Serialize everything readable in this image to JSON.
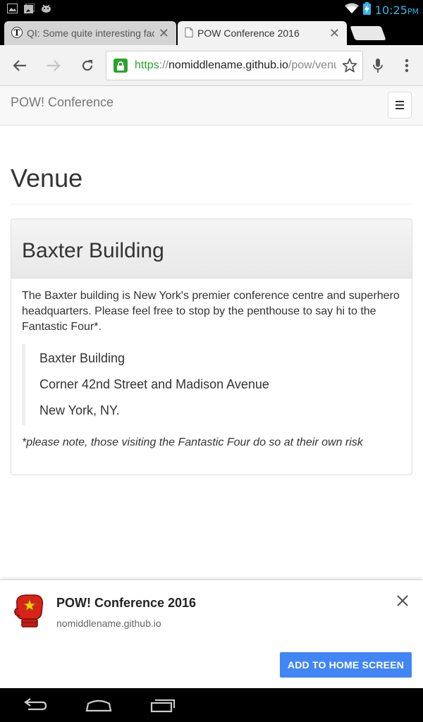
{
  "status_bar": {
    "time": "10:25",
    "ampm": "PM",
    "left_icons": [
      "image-icon",
      "photo-upload-icon",
      "android-icon"
    ],
    "right_icons": [
      "wifi-icon",
      "battery-charging-icon"
    ]
  },
  "tabs": [
    {
      "title": "QI: Some quite interesting facts",
      "favicon": "telegraph-icon",
      "active": false
    },
    {
      "title": "POW Conference 2016",
      "favicon": "page-icon",
      "active": true
    }
  ],
  "toolbar": {
    "url_scheme": "https",
    "url_sep": "://",
    "url_host": "nomiddlename.github.io",
    "url_path": "/pow/venue"
  },
  "page": {
    "brand": "POW! Conference",
    "heading": "Venue",
    "panel_title": "Baxter Building",
    "description": "The Baxter building is New York's premier conference centre and superhero headquarters. Please feel free to stop by the penthouse to say hi to the Fantastic Four*.",
    "address": [
      "Baxter Building",
      "Corner 42nd Street and Madison Avenue",
      "New York, NY."
    ],
    "note": "*please note, those visiting the Fantastic Four do so at their own risk"
  },
  "banner": {
    "title": "POW! Conference 2016",
    "url": "nomiddlename.github.io",
    "button": "ADD TO HOME SCREEN"
  },
  "colors": {
    "secure_green": "#2aa42a",
    "button_blue": "#4285f4",
    "status_time_blue": "#33b5e5"
  }
}
